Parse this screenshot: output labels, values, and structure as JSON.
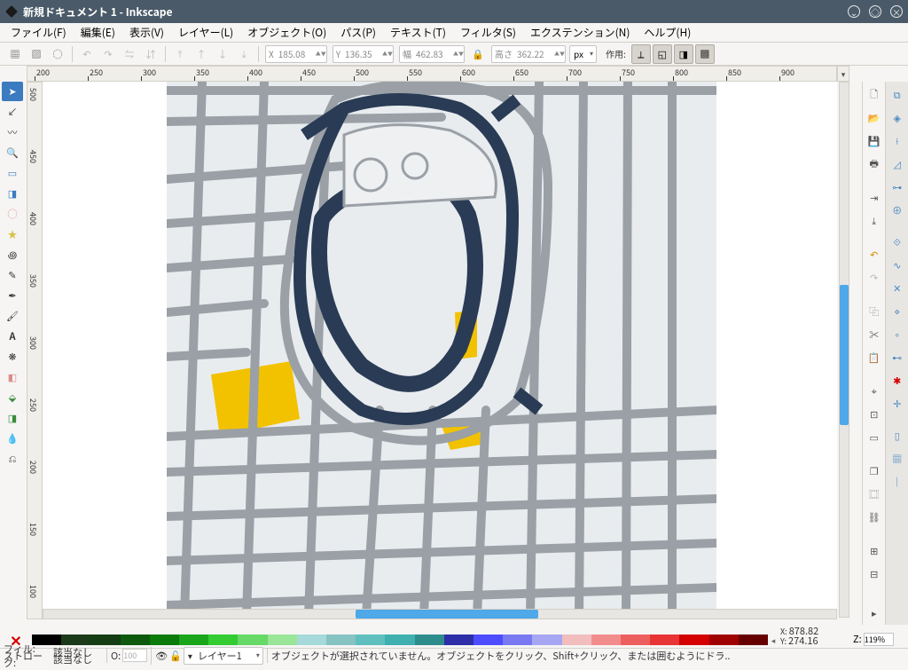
{
  "title": "新規ドキュメント 1 - Inkscape",
  "menu": [
    "ファイル(F)",
    "編集(E)",
    "表示(V)",
    "レイヤー(L)",
    "オブジェクト(O)",
    "パス(P)",
    "テキスト(T)",
    "フィルタ(S)",
    "エクステンション(N)",
    "ヘルプ(H)"
  ],
  "coords": {
    "x_lbl": "X",
    "x": "185.08",
    "y_lbl": "Y",
    "y": "136.35",
    "w_lbl": "幅",
    "w": "462.83",
    "h_lbl": "高さ",
    "h": "362.22",
    "unit": "px",
    "work_lbl": "作用:"
  },
  "ruler_h": [
    200,
    250,
    300,
    350,
    400,
    450,
    500,
    550,
    600,
    650,
    700,
    750,
    800,
    850,
    900
  ],
  "ruler_v": [
    500,
    450,
    400,
    350,
    300,
    250,
    200,
    150,
    100
  ],
  "fill_lbl": "フィル:",
  "stroke_lbl": "ストローク:",
  "fill_val": "該当なし",
  "stroke_val": "該当なし",
  "opacity_lbl": "O:",
  "opacity": "100",
  "layer_name": "レイヤー1",
  "status_msg": "オブジェクトが選択されていません。オブジェクトをクリック、Shift+クリック、または囲むようにドラ..",
  "cursor": {
    "x": "878.82",
    "y": "274.16"
  },
  "zoom_lbl": "Z:",
  "zoom": "119%",
  "palette": [
    "#000000",
    "#1a3a1a",
    "#143d14",
    "#0d590d",
    "#0a7a0a",
    "#1aa61a",
    "#33cc33",
    "#66d966",
    "#99e699",
    "#a6d9d9",
    "#86c3c3",
    "#5fbfbf",
    "#3fafaf",
    "#2e8c8c",
    "#2e2ea8",
    "#4d4dff",
    "#7979f2",
    "#a6a6f2",
    "#f2bdbd",
    "#f28c8c",
    "#ed5e5e",
    "#e83434",
    "#d40000",
    "#a00000",
    "#660000"
  ]
}
